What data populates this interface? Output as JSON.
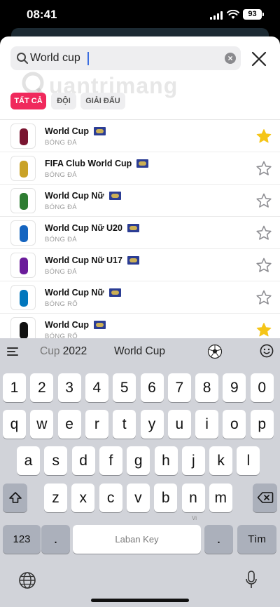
{
  "status_bar": {
    "time": "08:41",
    "battery": "93"
  },
  "search": {
    "query": "World cup"
  },
  "watermark": "uantrimang",
  "filters": [
    {
      "label": "TẤT CẢ",
      "active": true
    },
    {
      "label": "ĐỘI",
      "active": false
    },
    {
      "label": "GIẢI ĐẤU",
      "active": false
    }
  ],
  "results": [
    {
      "title": "World Cup",
      "subtitle": "BÓNG ĐÁ",
      "favorite": true,
      "logo_color": "#7a1530"
    },
    {
      "title": "FIFA Club World Cup",
      "subtitle": "BÓNG ĐÁ",
      "favorite": false,
      "logo_color": "#c9a227"
    },
    {
      "title": "World Cup Nữ",
      "subtitle": "BÓNG ĐÁ",
      "favorite": false,
      "logo_color": "#2e7d32"
    },
    {
      "title": "World Cup Nữ U20",
      "subtitle": "BÓNG ĐÁ",
      "favorite": false,
      "logo_color": "#1565c0"
    },
    {
      "title": "World Cup Nữ U17",
      "subtitle": "BÓNG ĐÁ",
      "favorite": false,
      "logo_color": "#6a1b9a"
    },
    {
      "title": "World Cup Nữ",
      "subtitle": "BÓNG RỔ",
      "favorite": false,
      "logo_color": "#0277bd"
    },
    {
      "title": "World Cup",
      "subtitle": "BÓNG RỔ",
      "favorite": true,
      "logo_color": "#111111"
    }
  ],
  "keyboard": {
    "suggestions": {
      "first_dim": "Cup",
      "first": "2022",
      "second": "World Cup"
    },
    "row_numbers": [
      "1",
      "2",
      "3",
      "4",
      "5",
      "6",
      "7",
      "8",
      "9",
      "0"
    ],
    "row1": [
      "q",
      "w",
      "e",
      "r",
      "t",
      "y",
      "u",
      "i",
      "o",
      "p"
    ],
    "row2": [
      "a",
      "s",
      "d",
      "f",
      "g",
      "h",
      "j",
      "k",
      "l"
    ],
    "row3": [
      "z",
      "x",
      "c",
      "v",
      "b",
      "n",
      "m"
    ],
    "key_123": "123",
    "key_dot": ".",
    "space_label": "Laban Key",
    "space_lang": "Vi",
    "go_label": "Tìm"
  },
  "colors": {
    "accent": "#f0295c",
    "star_active": "#f5c518",
    "star_inactive": "#8e8e93"
  }
}
